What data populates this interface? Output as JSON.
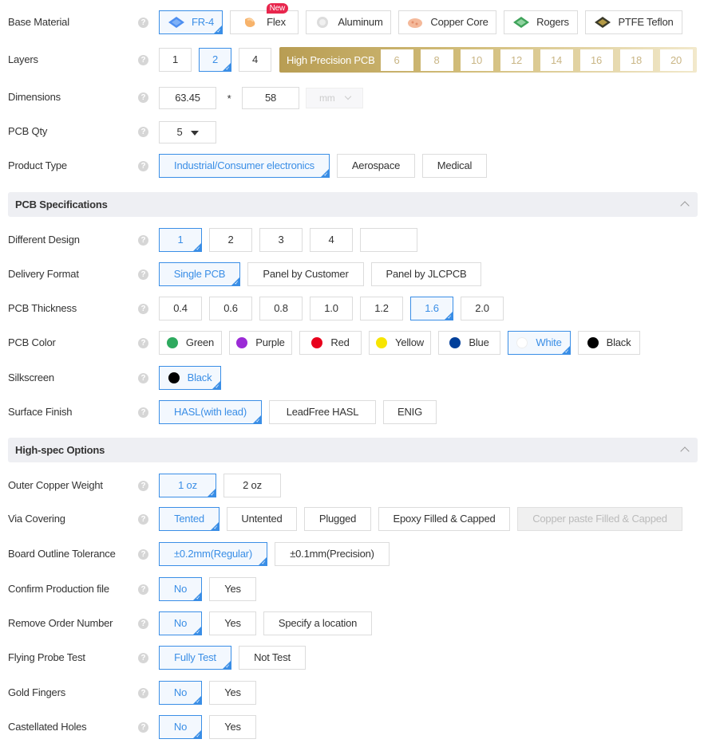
{
  "base_material": {
    "label": "Base Material",
    "options": [
      {
        "label": "FR-4",
        "icon": "fr4-board-icon",
        "selected": true
      },
      {
        "label": "Flex",
        "icon": "flex-board-icon",
        "badge": "New"
      },
      {
        "label": "Aluminum",
        "icon": "aluminum-board-icon"
      },
      {
        "label": "Copper Core",
        "icon": "copper-core-icon"
      },
      {
        "label": "Rogers",
        "icon": "rogers-board-icon"
      },
      {
        "label": "PTFE Teflon",
        "icon": "ptfe-board-icon"
      }
    ]
  },
  "layers": {
    "label": "Layers",
    "options": [
      "1",
      "2",
      "4"
    ],
    "selected": "2",
    "high_precision_label": "High Precision PCB",
    "high_precision_options": [
      "6",
      "8",
      "10",
      "12",
      "14",
      "16",
      "18",
      "20"
    ]
  },
  "dimensions": {
    "label": "Dimensions",
    "width": "63.45",
    "separator": "*",
    "height": "58",
    "unit": "mm"
  },
  "pcb_qty": {
    "label": "PCB Qty",
    "value": "5"
  },
  "product_type": {
    "label": "Product Type",
    "options": [
      "Industrial/Consumer electronics",
      "Aerospace",
      "Medical"
    ],
    "selected": "Industrial/Consumer electronics"
  },
  "sections": {
    "pcb_spec": "PCB Specifications",
    "high_spec": "High-spec Options"
  },
  "different_design": {
    "label": "Different Design",
    "options": [
      "1",
      "2",
      "3",
      "4",
      ""
    ],
    "selected": "1"
  },
  "delivery_format": {
    "label": "Delivery Format",
    "options": [
      "Single PCB",
      "Panel by Customer",
      "Panel by JLCPCB"
    ],
    "selected": "Single PCB"
  },
  "pcb_thickness": {
    "label": "PCB Thickness",
    "options": [
      "0.4",
      "0.6",
      "0.8",
      "1.0",
      "1.2",
      "1.6",
      "2.0"
    ],
    "selected": "1.6"
  },
  "pcb_color": {
    "label": "PCB Color",
    "options": [
      {
        "label": "Green",
        "color": "#2eaa5f"
      },
      {
        "label": "Purple",
        "color": "#9b2bd6"
      },
      {
        "label": "Red",
        "color": "#e8001c"
      },
      {
        "label": "Yellow",
        "color": "#f7e500"
      },
      {
        "label": "Blue",
        "color": "#003f9a"
      },
      {
        "label": "White",
        "color": "#ffffff"
      },
      {
        "label": "Black",
        "color": "#000000"
      }
    ],
    "selected": "White"
  },
  "silkscreen": {
    "label": "Silkscreen",
    "options": [
      {
        "label": "Black",
        "color": "#000000"
      }
    ],
    "selected": "Black"
  },
  "surface_finish": {
    "label": "Surface Finish",
    "options": [
      "HASL(with lead)",
      "LeadFree HASL",
      "ENIG"
    ],
    "selected": "HASL(with lead)"
  },
  "outer_copper": {
    "label": "Outer Copper Weight",
    "options": [
      "1 oz",
      "2 oz"
    ],
    "selected": "1 oz"
  },
  "via_covering": {
    "label": "Via Covering",
    "options": [
      "Tented",
      "Untented",
      "Plugged",
      "Epoxy Filled & Capped",
      "Copper paste Filled & Capped"
    ],
    "selected": "Tented",
    "disabled": "Copper paste Filled & Capped"
  },
  "board_outline": {
    "label": "Board Outline Tolerance",
    "options": [
      "±0.2mm(Regular)",
      "±0.1mm(Precision)"
    ],
    "selected": "±0.2mm(Regular)"
  },
  "confirm_production": {
    "label": "Confirm Production file",
    "options": [
      "No",
      "Yes"
    ],
    "selected": "No"
  },
  "remove_order": {
    "label": "Remove Order Number",
    "options": [
      "No",
      "Yes",
      "Specify a location"
    ],
    "selected": "No"
  },
  "flying_probe": {
    "label": "Flying Probe Test",
    "options": [
      "Fully Test",
      "Not Test"
    ],
    "selected": "Fully Test"
  },
  "gold_fingers": {
    "label": "Gold Fingers",
    "options": [
      "No",
      "Yes"
    ],
    "selected": "No"
  },
  "castellated": {
    "label": "Castellated Holes",
    "options": [
      "No",
      "Yes"
    ],
    "selected": "No"
  },
  "help_glyph": "?",
  "accent_color": "#3a8ee6"
}
